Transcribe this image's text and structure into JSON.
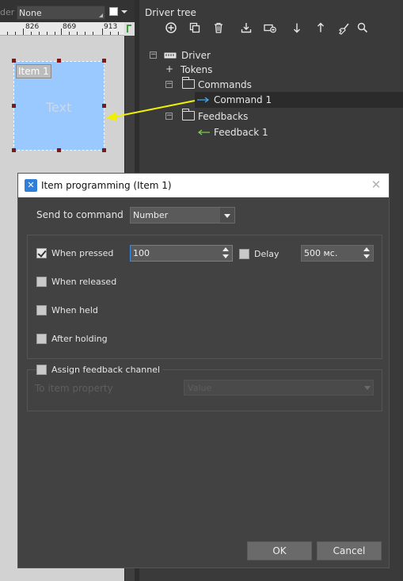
{
  "toolbar_left": {
    "order_label": "der",
    "order_value": "None"
  },
  "ruler": {
    "ticks": [
      "826",
      "869",
      "913"
    ]
  },
  "canvas_item": {
    "tag": "Item 1",
    "text": "Text"
  },
  "driver_tree": {
    "title": "Driver tree",
    "toolbar_icons": [
      "add-icon",
      "copy-icon",
      "delete-icon",
      "import-icon",
      "add-command-icon",
      "move-down-icon",
      "move-up-icon",
      "clean-icon",
      "search-icon"
    ],
    "nodes": {
      "driver": "Driver",
      "tokens": "Tokens",
      "commands": "Commands",
      "command1": "Command 1",
      "feedbacks": "Feedbacks",
      "feedback1": "Feedback 1"
    }
  },
  "dialog": {
    "title": "Item programming  (Item 1)",
    "send_to_command_label": "Send to command",
    "send_to_command_value": "Number",
    "when_pressed": {
      "label": "When pressed",
      "checked": true,
      "value": "100"
    },
    "delay": {
      "label": "Delay",
      "checked": false,
      "value": "500 мс."
    },
    "when_released": {
      "label": "When released",
      "checked": false
    },
    "when_held": {
      "label": "When held",
      "checked": false
    },
    "after_holding": {
      "label": "After holding",
      "checked": false
    },
    "assign_feedback": {
      "label": "Assign  feedback channel",
      "checked": false
    },
    "to_item_property_label": "To item property",
    "to_item_property_value": "Value",
    "ok_label": "OK",
    "cancel_label": "Cancel"
  },
  "colors": {
    "panel_bg": "#3a3a3a",
    "dialog_bg": "#424242",
    "item_fill": "#99c9ff",
    "arrow": "#f0f000",
    "command_arrow": "#3fa9f5",
    "feedback_arrow": "#7ec850",
    "focus_border": "#3b8de0"
  }
}
